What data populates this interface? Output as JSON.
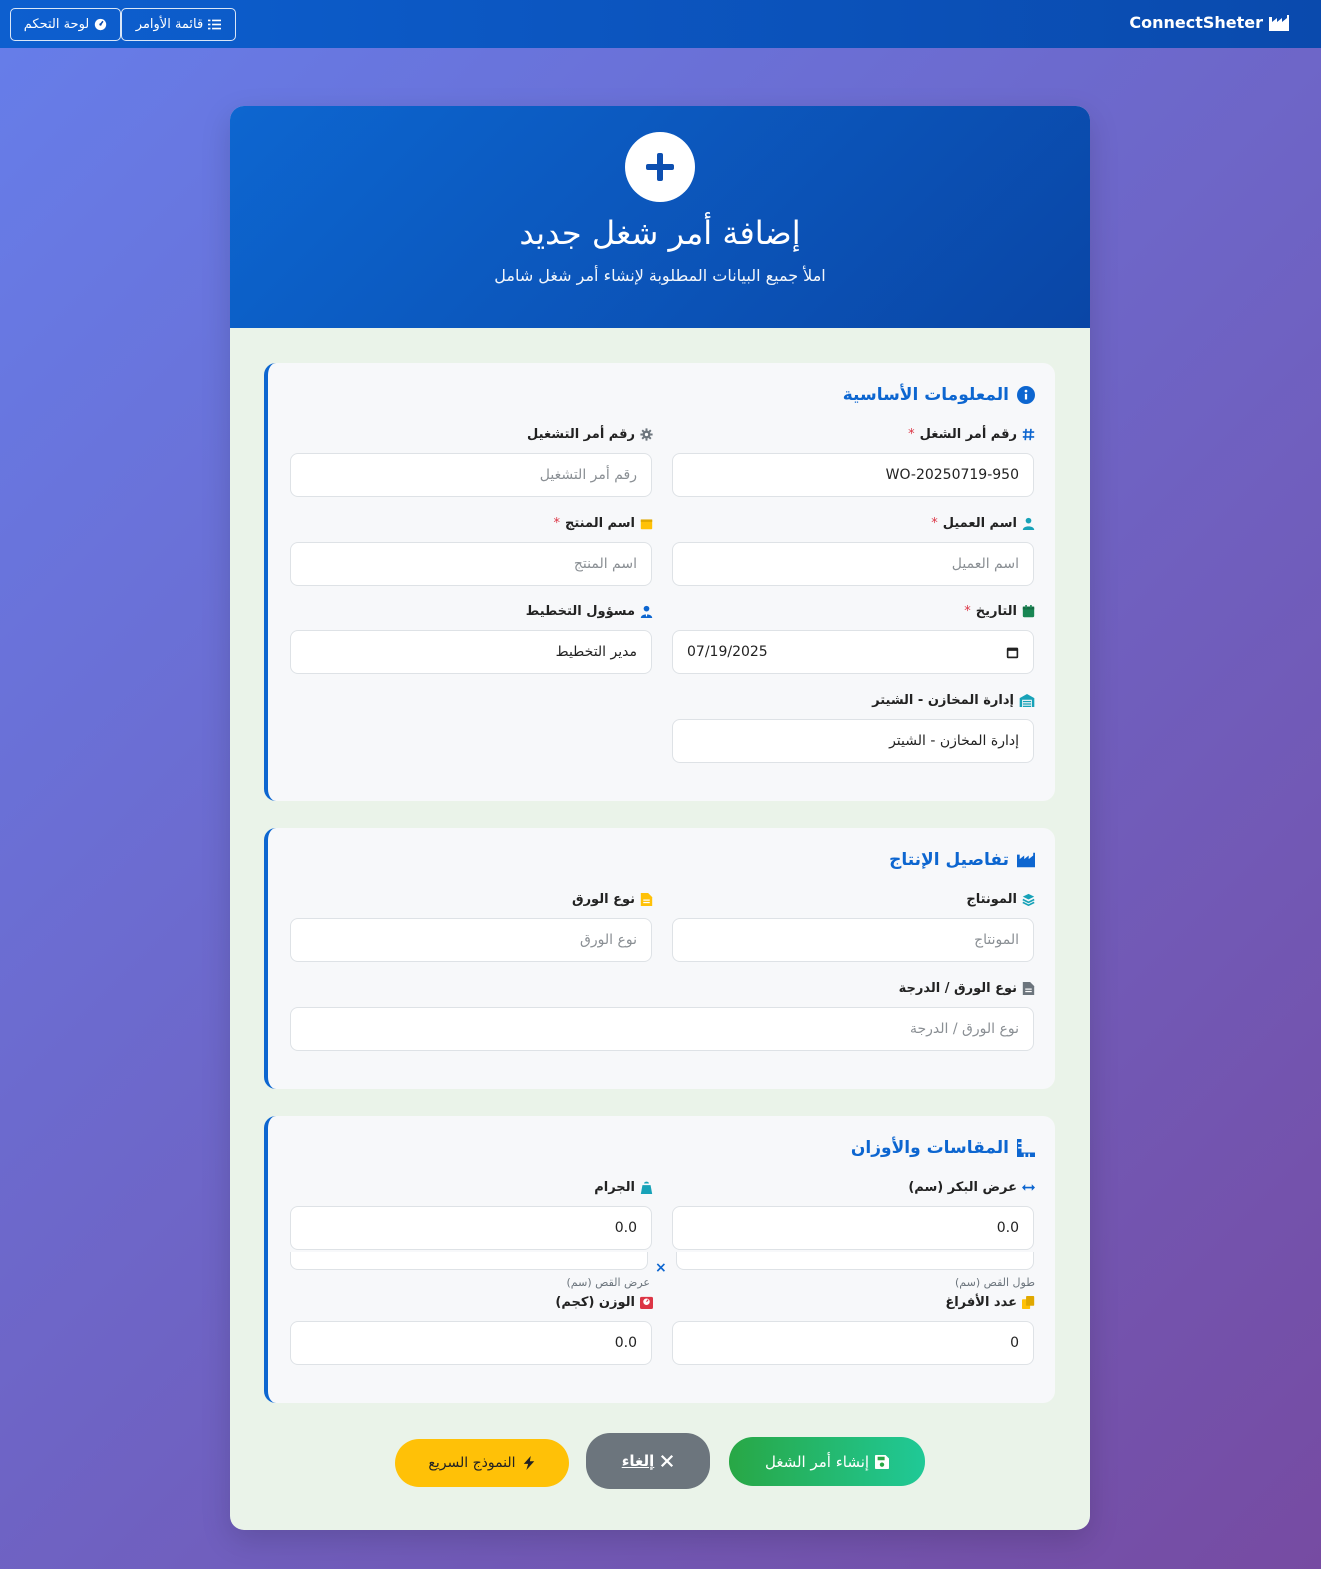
{
  "navbar": {
    "brand": "ConnectSheter",
    "orders_label": "قائمة الأوامر",
    "dashboard_label": "لوحة التحكم"
  },
  "header": {
    "title": "إضافة أمر شغل جديد",
    "subtitle": "املأ جميع البيانات المطلوبة لإنشاء أمر شغل شامل"
  },
  "basic": {
    "title": "المعلومات الأساسية",
    "work_order_label": "رقم أمر الشغل",
    "work_order_value": "WO-20250719-950",
    "operation_label": "رقم أمر التشغيل",
    "operation_placeholder": "رقم أمر التشغيل",
    "client_label": "اسم العميل",
    "client_placeholder": "اسم العميل",
    "product_label": "اسم المنتج",
    "product_placeholder": "اسم المنتج",
    "date_label": "التاريخ",
    "date_value": "07/19/2025",
    "planner_label": "مسؤول التخطيط",
    "planner_value": "مدير التخطيط",
    "warehouse_label": "إدارة المخازن - الشيتر",
    "warehouse_value": "إدارة المخازن - الشيتر",
    "required_mark": "*"
  },
  "production": {
    "title": "تفاصيل الإنتاج",
    "montage_label": "المونتاج",
    "montage_placeholder": "المونتاج",
    "paper_type_label": "نوع الورق",
    "paper_type_placeholder": "نوع الورق",
    "paper_grade_label": "نوع الورق / الدرجة",
    "paper_grade_placeholder": "نوع الورق / الدرجة"
  },
  "dimensions": {
    "title": "المقاسات والأوزان",
    "roll_width_label": "عرض البكر (سم)",
    "roll_width_value": "0.0",
    "gram_label": "الجرام",
    "gram_value": "0.0",
    "cut_length_hint": "طول القص (سم)",
    "cut_width_hint": "عرض القص (سم)",
    "times_symbol": "×",
    "blanks_label": "عدد الأفراغ",
    "blanks_value": "0",
    "weight_label": "الوزن (كجم)",
    "weight_value": "0.0"
  },
  "actions": {
    "create_label": "إنشاء أمر الشغل",
    "cancel_label": "إلغاء",
    "quick_label": "النموذج السريع"
  },
  "colors": {
    "primary": "#0d66d0",
    "success": "#28a745",
    "warning": "#ffc107",
    "secondary": "#6c757d",
    "danger": "#dc3545"
  }
}
